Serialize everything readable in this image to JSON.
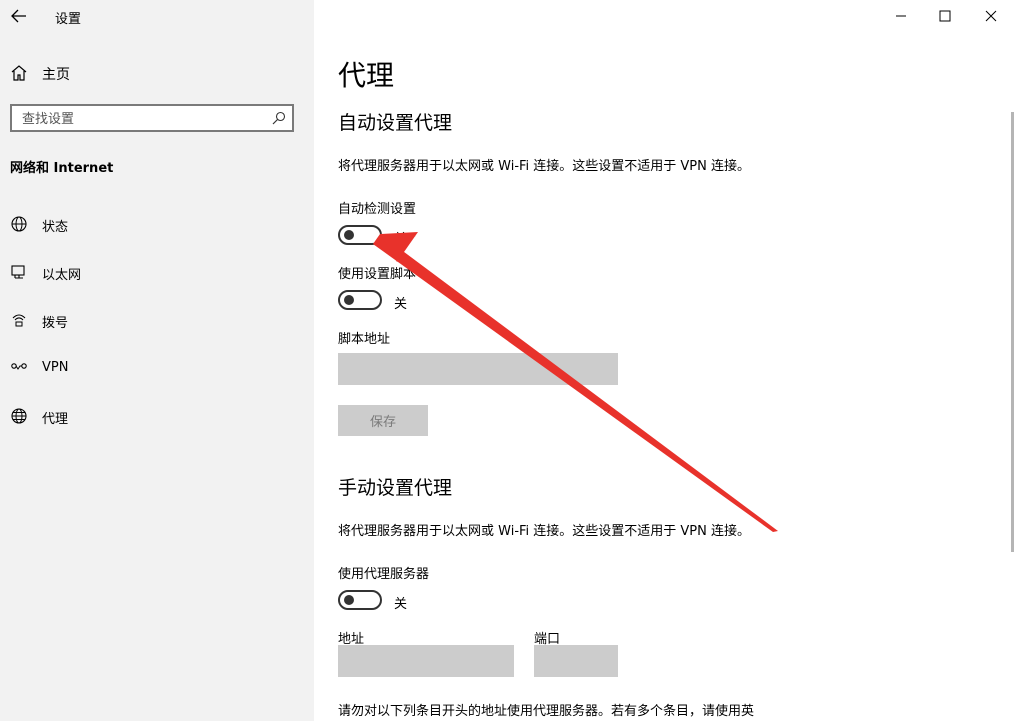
{
  "window": {
    "title": "设置"
  },
  "sidebar": {
    "home_label": "主页",
    "search_placeholder": "查找设置",
    "section_title": "网络和 Internet",
    "items": [
      {
        "label": "状态",
        "icon": "status-globe-icon"
      },
      {
        "label": "以太网",
        "icon": "ethernet-icon"
      },
      {
        "label": "拨号",
        "icon": "dialup-icon"
      },
      {
        "label": "VPN",
        "icon": "vpn-icon"
      },
      {
        "label": "代理",
        "icon": "proxy-globe-icon"
      }
    ]
  },
  "main": {
    "page_title": "代理",
    "auto": {
      "heading": "自动设置代理",
      "description": "将代理服务器用于以太网或 Wi-Fi 连接。这些设置不适用于 VPN 连接。",
      "detect_label": "自动检测设置",
      "detect_state": "关",
      "script_label": "使用设置脚本",
      "script_state": "关",
      "script_address_label": "脚本地址",
      "script_address_value": "",
      "save_label": "保存"
    },
    "manual": {
      "heading": "手动设置代理",
      "description": "将代理服务器用于以太网或 Wi-Fi 连接。这些设置不适用于 VPN 连接。",
      "use_proxy_label": "使用代理服务器",
      "use_proxy_state": "关",
      "address_label": "地址",
      "address_value": "",
      "port_label": "端口",
      "port_value": "",
      "exceptions_text": "请勿对以下列条目开头的地址使用代理服务器。若有多个条目，请使用英"
    }
  },
  "colors": {
    "sidebar_bg": "#f2f2f2",
    "input_disabled": "#cccccc",
    "annotation_arrow": "#e8322b"
  }
}
